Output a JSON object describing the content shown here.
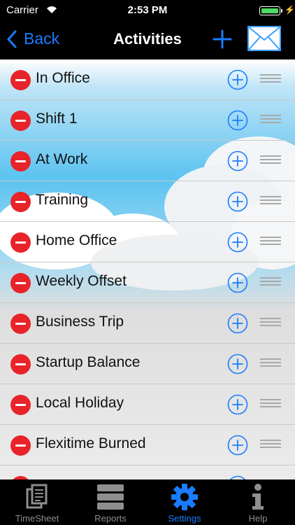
{
  "status_bar": {
    "carrier": "Carrier",
    "time": "2:53 PM"
  },
  "nav": {
    "back_label": "Back",
    "title": "Activities"
  },
  "activities": [
    "In Office",
    "Shift 1",
    "At Work",
    "Training",
    "Home Office",
    "Weekly Offset",
    "Business Trip",
    "Startup Balance",
    "Local Holiday",
    "Flexitime Burned"
  ],
  "tabs": [
    {
      "label": "TimeSheet",
      "icon": "timesheet-icon"
    },
    {
      "label": "Reports",
      "icon": "reports-icon"
    },
    {
      "label": "Settings",
      "icon": "gear-icon",
      "active": true
    },
    {
      "label": "Help",
      "icon": "info-icon"
    }
  ],
  "colors": {
    "accent": "#1a7cff",
    "delete": "#e8232a",
    "inactive_tab": "#8e8e8e"
  }
}
